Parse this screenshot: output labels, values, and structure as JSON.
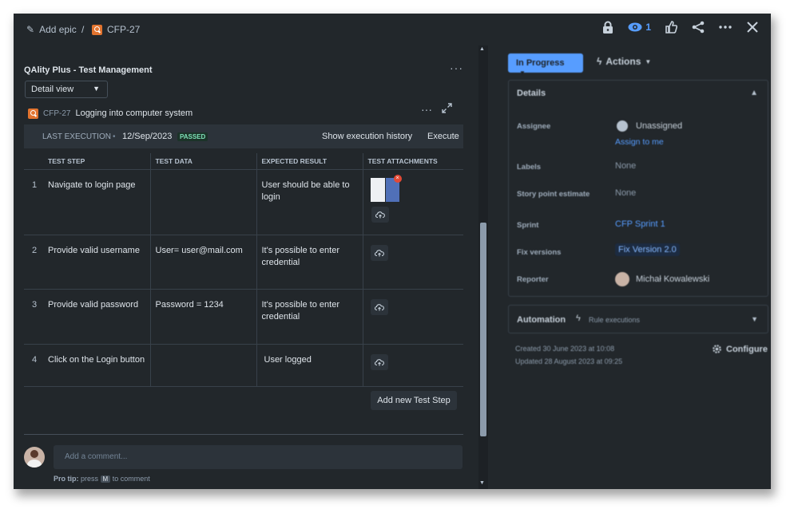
{
  "topbar": {
    "add_epic": "Add epic",
    "separator": "/",
    "issue_key": "CFP-27",
    "watch_count": "1",
    "icons": [
      "lock-icon",
      "eye-icon",
      "thumbs-up-icon",
      "share-icon",
      "more-icon",
      "close-icon"
    ]
  },
  "panel": {
    "title": "QAlity Plus - Test Management",
    "view_select": "Detail view",
    "case_key": "CFP-27",
    "case_title": "Logging into computer system",
    "last_execution_label": "LAST EXECUTION",
    "last_execution_date": "12/Sep/2023",
    "last_execution_status": "PASSED",
    "show_history": "Show execution history",
    "execute": "Execute",
    "columns": [
      "TEST STEP",
      "TEST DATA",
      "EXPECTED RESULT",
      "TEST ATTACHMENTS"
    ],
    "steps": [
      {
        "num": "1",
        "step": "Navigate to login page",
        "data": "",
        "expected": "User should be able to login"
      },
      {
        "num": "2",
        "step": "Provide valid username",
        "data": "User= user@mail.com",
        "expected": "It's possible to enter credential"
      },
      {
        "num": "3",
        "step": "Provide valid password",
        "data": "Password = 1234",
        "expected": "It's possible to enter credential"
      },
      {
        "num": "4",
        "step": "Click on the Login button",
        "data": "",
        "expected": "User logged"
      }
    ],
    "add_step": "Add new Test Step",
    "comment_placeholder": "Add a comment...",
    "protip_bold": "Pro tip:",
    "protip_press": "press",
    "protip_key": "M",
    "protip_rest": "to comment"
  },
  "sidebar": {
    "status": "In Progress",
    "actions": "Actions",
    "details_title": "Details",
    "fields": {
      "assignee_label": "Assignee",
      "assignee_value": "Unassigned",
      "assign_to_me": "Assign to me",
      "labels_label": "Labels",
      "labels_value": "None",
      "story_label": "Story point estimate",
      "story_value": "None",
      "sprint_label": "Sprint",
      "sprint_value": "CFP Sprint 1",
      "fix_label": "Fix versions",
      "fix_value": "Fix Version 2.0",
      "reporter_label": "Reporter",
      "reporter_value": "Michał Kowalewski"
    },
    "automation_title": "Automation",
    "automation_sub": "Rule executions",
    "created": "Created 30 June 2023 at 10:08",
    "updated": "Updated 28 August 2023 at 09:25",
    "configure": "Configure"
  }
}
